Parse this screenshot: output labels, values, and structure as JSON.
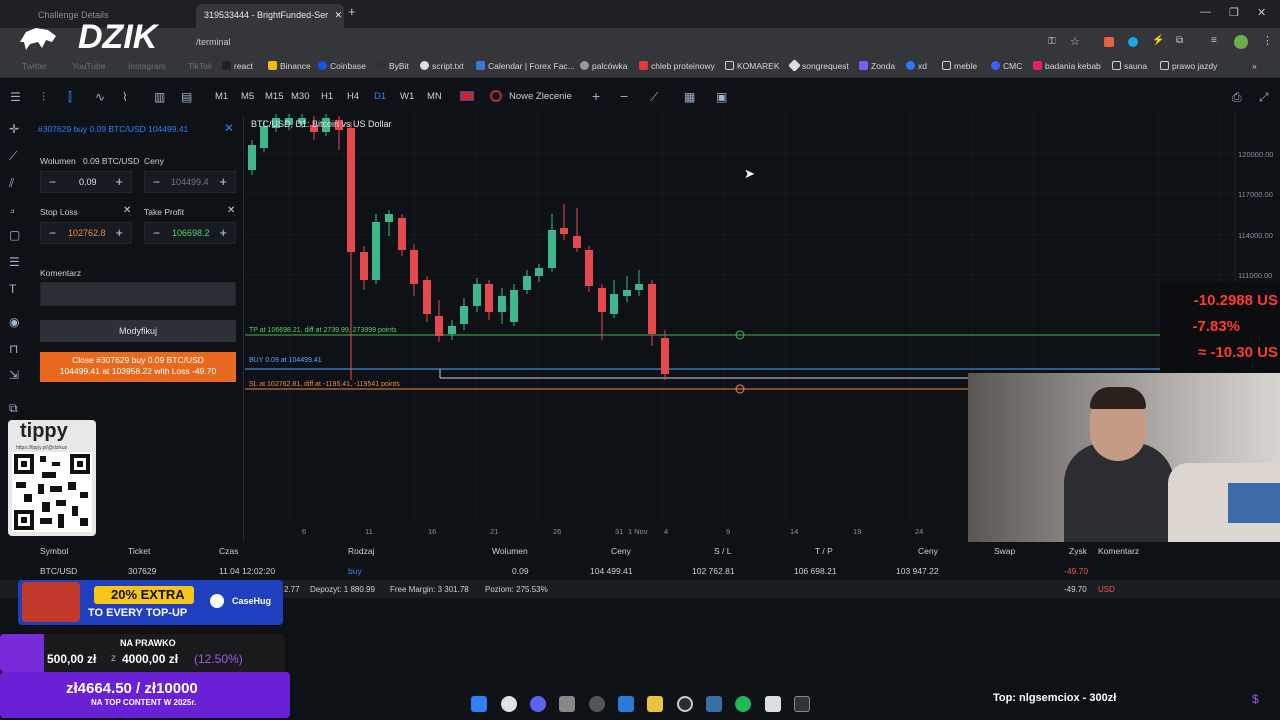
{
  "browser": {
    "tabs": [
      "Challenge Details",
      "319533444 - BrightFunded-Ser"
    ],
    "url": "/terminal",
    "bookmarks": [
      "react",
      "Binance",
      "Coinbase",
      "ByBit",
      "script.txt",
      "Calendar | Forex Fac...",
      "palcówka",
      "chleb proteinowy",
      "KOMAREK",
      "songrequest",
      "Zonda",
      "xd",
      "meble",
      "CMC",
      "badania kebab",
      "sauna",
      "prawo jazdy"
    ],
    "faded_bookmarks": [
      "Twitter",
      "YouTube",
      "Instagram",
      "TikTok"
    ]
  },
  "stream": {
    "logo": "DZIK",
    "tippy_brand": "tippy",
    "tippy_url": "https://tippy.pl/@dzikus",
    "promo_text": "20% EXTRA",
    "promo_sub": "TO EVERY TOP-UP",
    "promo_brand": "CaseHug",
    "goal_label": "NA PRAWKO",
    "goal_current": "500,00 zł",
    "goal_of": "z",
    "goal_target": "4000,00 zł",
    "goal_pct": "(12.50%)",
    "goal2_value": "zł4664.50 / zł10000",
    "goal2_label": "NA TOP CONTENT W 2025r.",
    "top_donor": "Top: nlgsemciox - 300zł"
  },
  "toolbar": {
    "timeframes": [
      "M1",
      "M5",
      "M15",
      "M30",
      "H1",
      "H4",
      "D1",
      "W1",
      "MN"
    ],
    "active_timeframe": "D1",
    "new_order": "Nowe Zlecenie"
  },
  "order_panel": {
    "header": "#307629 buy 0.09 BTC/USD 104499.41",
    "volume_label": "Wolumen",
    "volume_unit": "0.09 BTC/USD",
    "prices_label": "Ceny",
    "volume_value": "0.09",
    "price_value": "104499.4",
    "stop_loss_label": "Stop Loss",
    "take_profit_label": "Take Profit",
    "stop_loss_value": "102762.8",
    "take_profit_value": "106698.2",
    "comment_label": "Komentarz",
    "modify_button": "Modyfikuj",
    "close_button_line1": "Close #307629 buy 0.09 BTC/USD",
    "close_button_line2": "104499.41 at 103958.22 with Loss -49.70"
  },
  "chart": {
    "title": "BTC/USD, D1: Bitcoin vs US Dollar",
    "y_ticks": [
      "120000.00",
      "117000.00",
      "114000.00",
      "111000.00"
    ],
    "x_ticks": [
      "6",
      "11",
      "16",
      "21",
      "26",
      "31",
      "1 Nov",
      "4",
      "9",
      "14",
      "19",
      "24"
    ],
    "tp_label": "TP at 106698.21, diff at 2739.99, 273999 points",
    "buy_label": "BUY 0.09 at 104499.41",
    "sl_label": "SL at 102762.81, diff at -1195.41, -119541 points",
    "pl_values": [
      "-10.2988 US",
      "-7.83%",
      "≈ -10.30 US"
    ]
  },
  "chart_data": {
    "type": "candlestick",
    "title": "BTC/USD, D1: Bitcoin vs US Dollar",
    "x": [
      "6",
      "11",
      "16",
      "21",
      "26",
      "31",
      "1 Nov",
      "4"
    ],
    "levels": {
      "take_profit": 106698.21,
      "entry": 104499.41,
      "stop_loss": 102762.81
    },
    "ylim": [
      102000,
      121000
    ]
  },
  "positions": {
    "headers": [
      "Symbol",
      "Ticket",
      "Czas",
      "Rodzaj",
      "Wolumen",
      "Ceny",
      "S / L",
      "T / P",
      "Ceny",
      "Swap",
      "Zysk",
      "Komentarz"
    ],
    "row": [
      "BTC/USD",
      "307629",
      "11.04 12:02:20",
      "buy",
      "0.09",
      "104 499.41",
      "102 762.81",
      "106 698.21",
      "103 947.22",
      "",
      "-49.70",
      ""
    ],
    "summary": [
      "2.77",
      "Depozyt: 1 880.99",
      "Free Margin: 3 301.78",
      "Poziom: 275.53%"
    ],
    "summary_pl": "-49.70",
    "summary_ccy": "USD"
  }
}
